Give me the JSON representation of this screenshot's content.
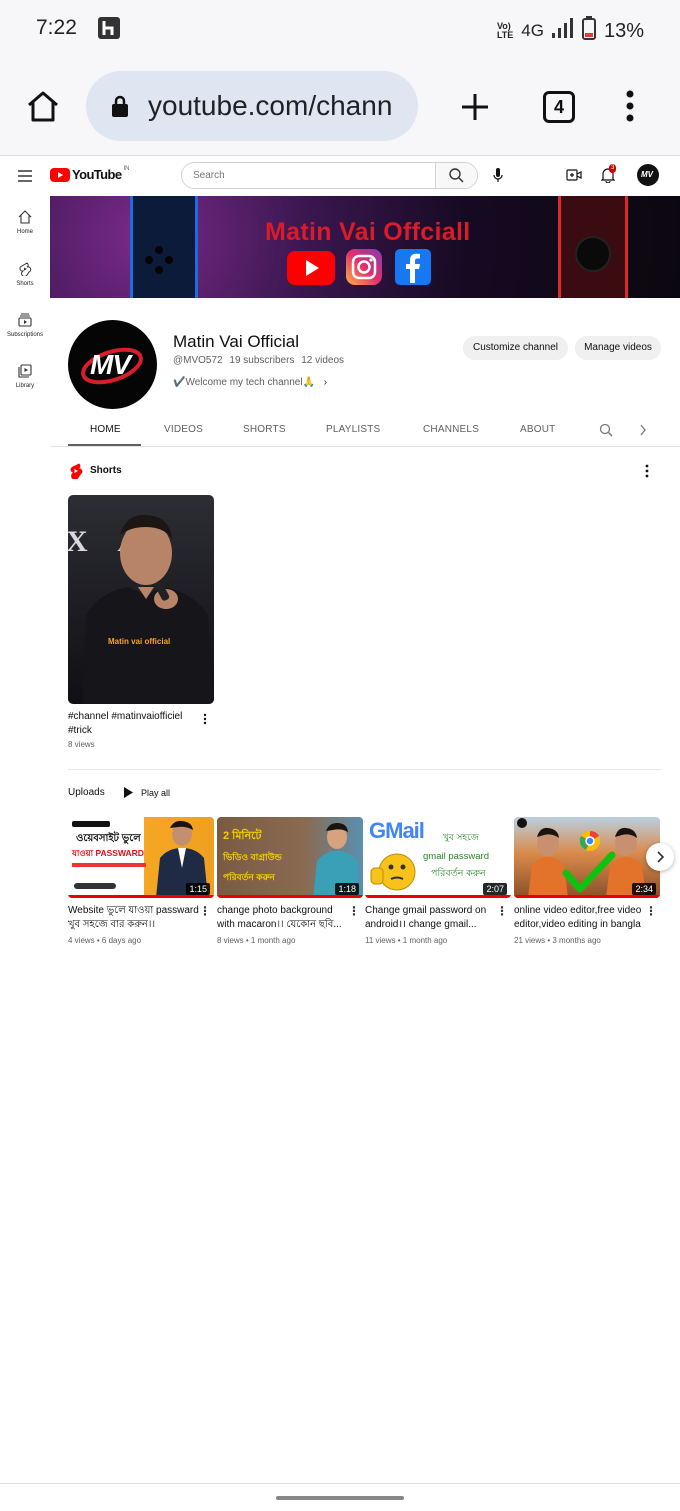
{
  "status_bar": {
    "time": "7:22",
    "network_top": "Vo)",
    "network_bottom": "LTE",
    "network": "4G",
    "battery": "13%"
  },
  "browser": {
    "url": "youtube.com/chann",
    "tab_count": "4"
  },
  "yt_header": {
    "logo_text": "YouTube",
    "region": "IN",
    "search_placeholder": "Search",
    "notification_count": "3"
  },
  "sidebar": {
    "items": [
      {
        "label": "Home",
        "icon": "home-icon"
      },
      {
        "label": "Shorts",
        "icon": "shorts-icon"
      },
      {
        "label": "Subscriptions",
        "icon": "subscriptions-icon"
      },
      {
        "label": "Library",
        "icon": "library-icon"
      }
    ]
  },
  "banner": {
    "title": "Matin Vai Offciall"
  },
  "channel": {
    "avatar_text": "MV",
    "name": "Matin Vai Official",
    "handle": "@MVO572",
    "subscribers": "19 subscribers",
    "videos": "12 videos",
    "description": "✔️Welcome my tech channel🙏",
    "customize_label": "Customize channel",
    "manage_label": "Manage videos"
  },
  "tabs": [
    "HOME",
    "VIDEOS",
    "SHORTS",
    "PLAYLISTS",
    "CHANNELS",
    "ABOUT"
  ],
  "shorts_section": {
    "title": "Shorts",
    "item": {
      "thumb_text": "Matin vai official",
      "thumb_letters": "X A",
      "title": "#channel #matinvaiofficiel #trick",
      "views": "8 views"
    }
  },
  "uploads": {
    "title": "Uploads",
    "play_all": "Play all",
    "videos": [
      {
        "thumb_line1": "ওয়েবসাইট ভুলে",
        "thumb_line2": "যাওয়া PASSWARD",
        "duration": "1:15",
        "title": "Website ভুলে যাওয়া passward খুব সহজে বার করুন।।",
        "meta": "4 views • 6 days ago"
      },
      {
        "thumb_line1": "2 মিনিটে",
        "thumb_line2": "ভিডিও বাগ্রাউন্ড",
        "thumb_line3": "পরিবর্তন করুন",
        "duration": "1:18",
        "title": "change photo background with macaron।। যেকোন ছবি...",
        "meta": "8 views • 1 month ago"
      },
      {
        "thumb_line1": "GMail",
        "thumb_line2": "খুব সহজে",
        "thumb_line3": "gmail passward",
        "thumb_line4": "পরিবর্তন করুন",
        "duration": "2:07",
        "title": "Change gmail password on android।। change gmail...",
        "meta": "11 views • 1 month ago"
      },
      {
        "duration": "2:34",
        "title": "online video editor,free video editor,video editing in bangla",
        "meta": "21 views • 3 months ago"
      }
    ]
  }
}
